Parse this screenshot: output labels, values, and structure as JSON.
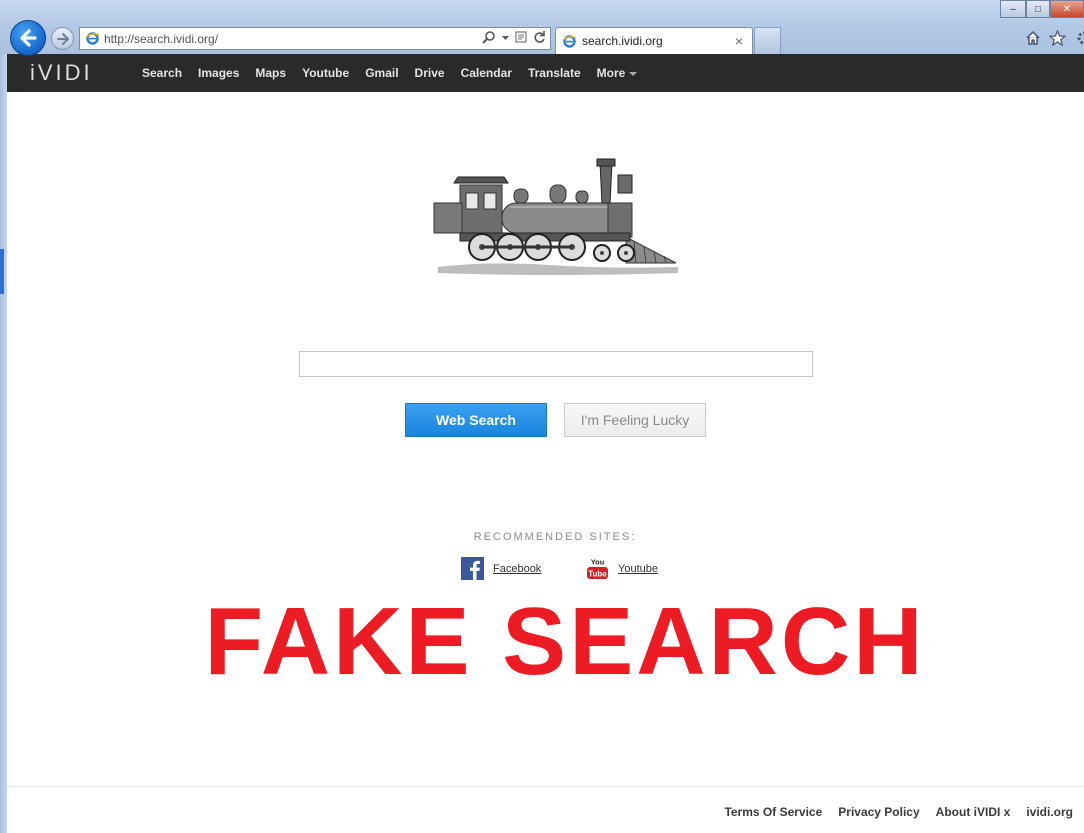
{
  "browser": {
    "address_url": "http://search.ividi.org/",
    "tab_title": "search.ividi.org",
    "tab_close": "×",
    "window_controls": {
      "minimize": "–",
      "maximize": "□",
      "close": "✕"
    },
    "icons": [
      "back-arrow-icon",
      "forward-arrow-icon",
      "ie-icon",
      "search-icon",
      "dropdown-icon",
      "compat-view-icon",
      "refresh-icon",
      "home-icon",
      "favorites-star-icon",
      "gear-icon"
    ]
  },
  "site": {
    "logo": "iVIDI",
    "nav": [
      "Search",
      "Images",
      "Maps",
      "Youtube",
      "Gmail",
      "Drive",
      "Calendar",
      "Translate"
    ],
    "nav_more": "More"
  },
  "search": {
    "value": "",
    "web_search_label": "Web Search",
    "lucky_label": "I'm Feeling Lucky"
  },
  "recommended": {
    "heading": "RECOMMENDED SITES:",
    "sites": [
      {
        "name": "Facebook",
        "icon": "facebook-icon"
      },
      {
        "name": "Youtube",
        "icon": "youtube-icon",
        "icon_text": [
          "You",
          "Tube"
        ]
      }
    ]
  },
  "overlay_text": "FAKE SEARCH",
  "footer": [
    "Terms Of Service",
    "Privacy Policy",
    "About iVIDI x",
    "ividi.org"
  ],
  "colors": {
    "nav_bg": "#2a2a2a",
    "primary_button": "#1a83dd",
    "overlay": "#ed1c24"
  }
}
